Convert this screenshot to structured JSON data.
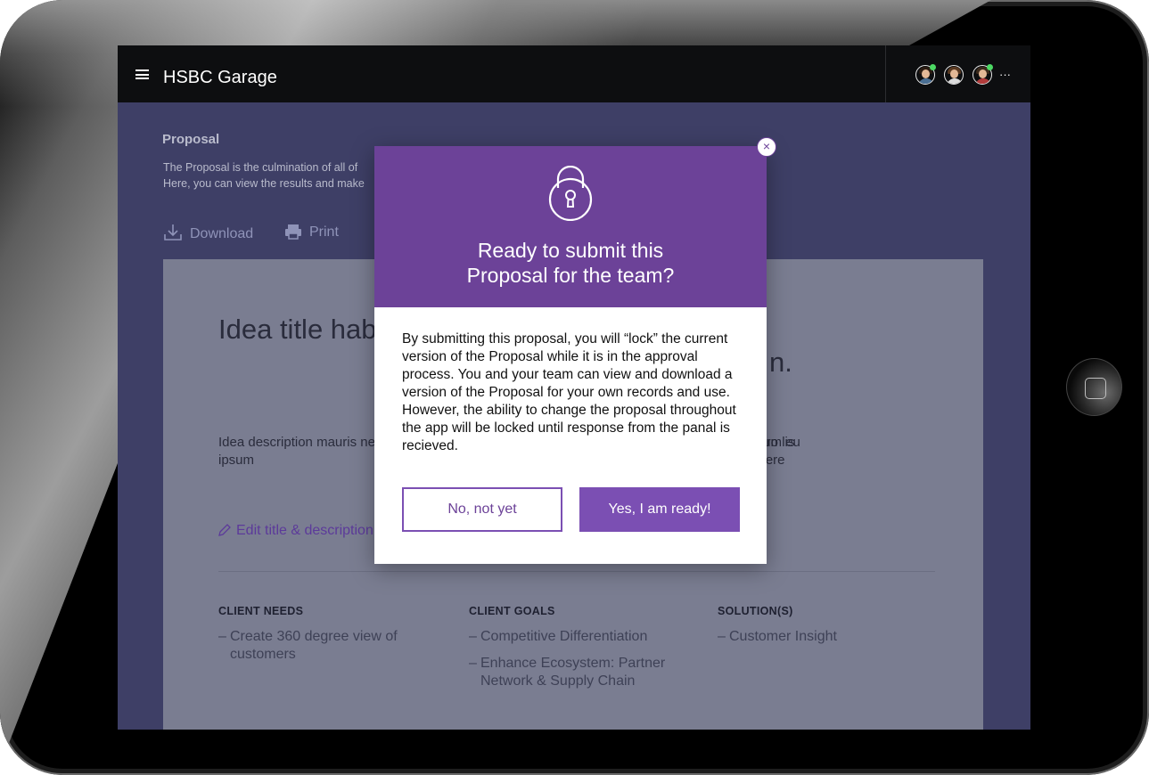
{
  "header": {
    "app_title": "HSBC Garage",
    "more_label": "···"
  },
  "collaborators": [
    {
      "name": "avatar-1",
      "hair": "#2b1c12",
      "shirt": "#4a6f94"
    },
    {
      "name": "avatar-2",
      "hair": "#5a3a22",
      "shirt": "#dcdcdc"
    },
    {
      "name": "avatar-3",
      "hair": "#3b2a1c",
      "shirt": "#b23b3b"
    }
  ],
  "page": {
    "heading": "Proposal",
    "description_line1": "The Proposal is the culmination of all of",
    "description_line2": "Here, you can view the results and make",
    "download_label": "Download",
    "print_label": "Print"
  },
  "document": {
    "title": "Idea title hab adipiscing fe Integer et elit",
    "title_tail": "n.",
    "description": "Idea description mauris ne posuere vulputate. Etiam pellentesque, lacinia dui s posuere, rutrum eu ipsum",
    "description_tail": "bero lis suere",
    "edit_label": "Edit title & description",
    "columns": {
      "needs": {
        "heading": "CLIENT NEEDS",
        "items": [
          "Create 360 degree view of customers"
        ]
      },
      "goals": {
        "heading": "CLIENT GOALS",
        "items": [
          "Competitive Differentiation",
          "Enhance Ecosystem: Partner Network & Supply Chain"
        ]
      },
      "solutions": {
        "heading": "SOLUTION(S)",
        "items": [
          "Customer Insight"
        ]
      }
    },
    "dash": "–"
  },
  "modal": {
    "title": "Ready to submit this\nProposal for the team?",
    "body": "By submitting this proposal, you will “lock” the current version of the Proposal while it is in the approval process. You and your team can view and download a version of the Proposal for your own records and use. However, the ability to change the proposal throughout the app will be locked until response from the panal is recieved.",
    "cancel_label": "No, not yet",
    "confirm_label": "Yes, I am ready!",
    "close_label": "×"
  },
  "colors": {
    "modal_header": "#6c4298",
    "primary_button": "#7b4fb3",
    "topbar": "#0d0e10",
    "overlay": "#3e3f66",
    "presence": "#4cd964"
  }
}
